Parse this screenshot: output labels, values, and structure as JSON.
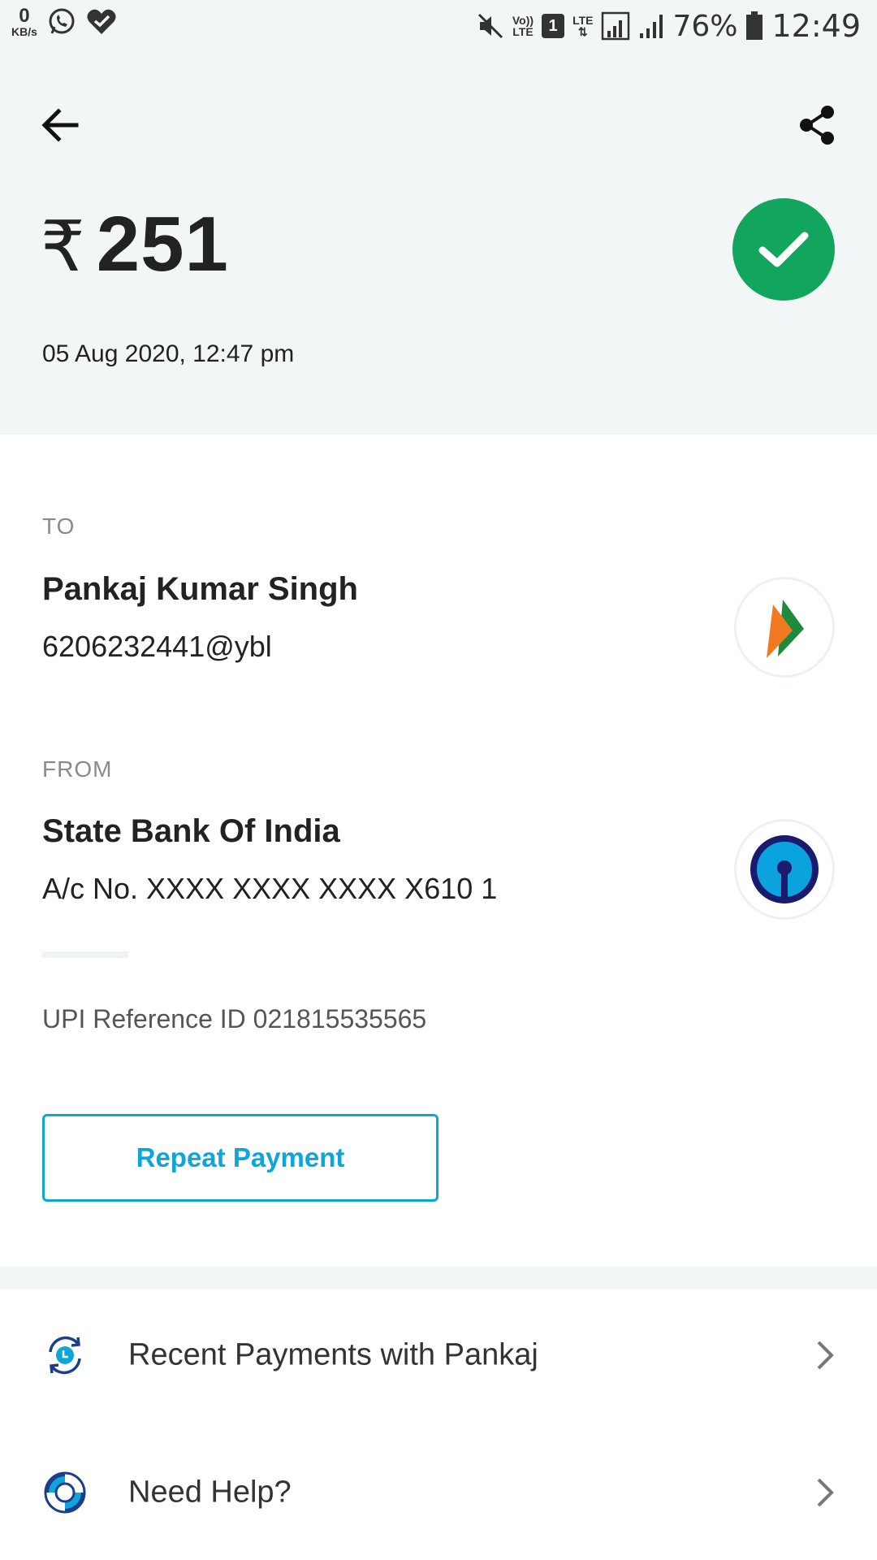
{
  "status_bar": {
    "data_rate": "0",
    "data_unit": "KB/s",
    "volte_top": "Vo))",
    "volte_bottom": "LTE",
    "sim": "1",
    "lte": "LTE",
    "battery": "76%",
    "time": "12:49"
  },
  "header": {
    "currency_symbol": "₹",
    "amount": "251",
    "datetime": "05 Aug 2020, 12:47 pm",
    "status_color": "#12a55d"
  },
  "to": {
    "label": "TO",
    "name": "Pankaj Kumar Singh",
    "upi_id": "6206232441@ybl",
    "logo_icon": "bhim-upi-icon"
  },
  "from": {
    "label": "FROM",
    "name": "State Bank Of India",
    "account": "A/c No. XXXX XXXX XXXX X610 1",
    "logo_icon": "sbi-icon"
  },
  "reference": {
    "text": "UPI Reference ID 021815535565"
  },
  "actions": {
    "repeat_label": "Repeat Payment",
    "accent_color": "#0ea6d8"
  },
  "list": [
    {
      "label": "Recent Payments with Pankaj",
      "icon": "recent-payments-icon"
    },
    {
      "label": "Need Help?",
      "icon": "lifebuoy-icon"
    }
  ]
}
